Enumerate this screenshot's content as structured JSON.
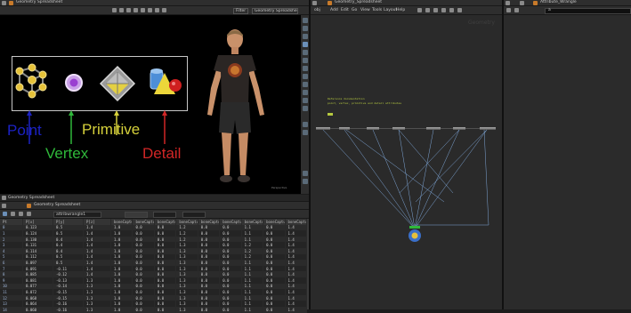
{
  "left_pane": {
    "path": "Geometry Spreadsheet",
    "viewport_buttons": [
      "Filter",
      "Geometry Spreadsheet"
    ]
  },
  "diagram": {
    "labels": [
      {
        "text": "Point",
        "color": "#1c22c4"
      },
      {
        "text": "Vertex",
        "color": "#2fb83a"
      },
      {
        "text": "Primitive",
        "color": "#d6d13b"
      },
      {
        "text": "Detail",
        "color": "#d12626"
      }
    ],
    "watermark": "Perspective"
  },
  "spreadsheet": {
    "title": "Geometry Spreadsheet",
    "node_field": "attribwrangle1",
    "group_field": "",
    "columns": [
      "Pt",
      "P[x]",
      "P[y]",
      "P[z]",
      "boneCapture[0]",
      "boneCapture[1]",
      "boneCapture[2]",
      "boneCapture[3]",
      "boneCapture[4]",
      "boneCapture[5]",
      "boneCapture[6]",
      "boneCapture[7]",
      "boneCapture[8]"
    ],
    "rows": [
      [
        "0",
        "0.123",
        "0.5",
        "1.4",
        "1.0",
        "0.0",
        "0.0",
        "1.2",
        "0.0",
        "0.0",
        "1.1",
        "0.0",
        "1.4"
      ],
      [
        "1",
        "0.124",
        "0.5",
        "1.4",
        "1.0",
        "0.0",
        "0.0",
        "1.2",
        "0.0",
        "0.0",
        "1.1",
        "0.0",
        "1.4"
      ],
      [
        "2",
        "0.130",
        "0.4",
        "1.4",
        "1.0",
        "0.0",
        "0.0",
        "1.2",
        "0.0",
        "0.0",
        "1.1",
        "0.0",
        "1.4"
      ],
      [
        "3",
        "0.131",
        "0.4",
        "1.4",
        "1.0",
        "0.0",
        "0.0",
        "1.3",
        "0.0",
        "0.0",
        "1.2",
        "0.0",
        "1.4"
      ],
      [
        "4",
        "0.114",
        "0.4",
        "1.4",
        "1.0",
        "0.0",
        "0.0",
        "1.3",
        "0.0",
        "0.0",
        "1.2",
        "0.0",
        "1.4"
      ],
      [
        "5",
        "0.112",
        "0.5",
        "1.4",
        "1.0",
        "0.0",
        "0.0",
        "1.3",
        "0.0",
        "0.0",
        "1.2",
        "0.0",
        "1.4"
      ],
      [
        "6",
        "0.097",
        "0.5",
        "1.4",
        "1.0",
        "0.0",
        "0.0",
        "1.3",
        "0.0",
        "0.0",
        "1.1",
        "0.0",
        "1.4"
      ],
      [
        "7",
        "0.091",
        "-0.11",
        "1.4",
        "1.0",
        "0.0",
        "0.0",
        "1.3",
        "0.0",
        "0.0",
        "1.1",
        "0.0",
        "1.4"
      ],
      [
        "8",
        "0.085",
        "-0.12",
        "1.4",
        "1.0",
        "0.0",
        "0.0",
        "1.3",
        "0.0",
        "0.0",
        "1.1",
        "0.0",
        "1.4"
      ],
      [
        "9",
        "0.081",
        "-0.13",
        "1.3",
        "1.0",
        "0.0",
        "0.0",
        "1.3",
        "0.0",
        "0.0",
        "1.1",
        "0.0",
        "1.4"
      ],
      [
        "10",
        "0.077",
        "-0.14",
        "1.3",
        "1.0",
        "0.0",
        "0.0",
        "1.3",
        "0.0",
        "0.0",
        "1.1",
        "0.0",
        "1.4"
      ],
      [
        "11",
        "0.072",
        "-0.15",
        "1.3",
        "1.0",
        "0.0",
        "0.0",
        "1.3",
        "0.0",
        "0.0",
        "1.1",
        "0.0",
        "1.4"
      ],
      [
        "12",
        "0.068",
        "-0.15",
        "1.3",
        "1.0",
        "0.0",
        "0.0",
        "1.3",
        "0.0",
        "0.0",
        "1.1",
        "0.0",
        "1.4"
      ],
      [
        "13",
        "0.064",
        "-0.16",
        "1.3",
        "1.0",
        "0.0",
        "0.0",
        "1.3",
        "0.0",
        "0.0",
        "1.1",
        "0.0",
        "1.4"
      ],
      [
        "14",
        "0.060",
        "-0.16",
        "1.3",
        "1.0",
        "0.0",
        "0.0",
        "1.3",
        "0.0",
        "0.0",
        "1.1",
        "0.0",
        "1.4"
      ]
    ]
  },
  "network_pane": {
    "path": "obj",
    "breadcrumb": "Geometry_Spreadsheet",
    "menu": [
      "Add",
      "Edit",
      "Go",
      "View",
      "Tools",
      "Layout",
      "Help"
    ],
    "watermark": "Geometry",
    "sticky_note": [
      "Reference documentation",
      "point, vertex, primitive and detail attributes"
    ]
  },
  "right_pane": {
    "path": "Attribute_Wrangle",
    "field": "a"
  },
  "colors": {
    "point": "#1c22c4",
    "vertex": "#2fb83a",
    "primitive": "#d6d13b",
    "detail": "#d12626",
    "node_line": "#7fa7d8",
    "sticky": "#cfe03a"
  }
}
